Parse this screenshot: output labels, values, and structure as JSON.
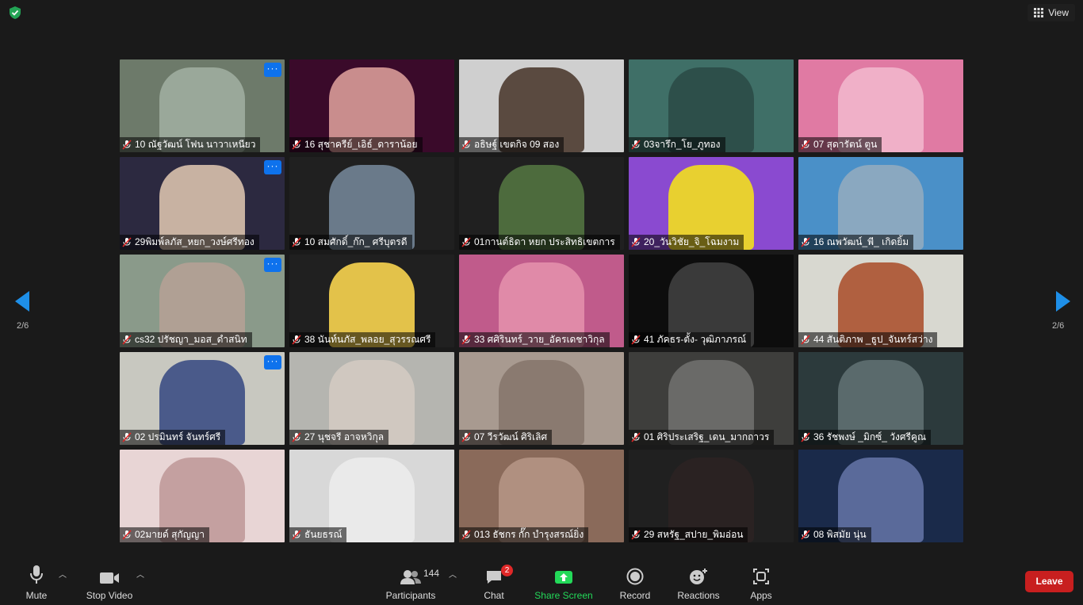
{
  "topbar": {
    "view_label": "View"
  },
  "pagination": {
    "left": "2/6",
    "right": "2/6"
  },
  "tiles": [
    {
      "name": "10 ณัฐวัฒน์ โฟน นาวาเหนียว",
      "bg": "#6d7a6a",
      "inner": "#9aa89a",
      "more": true
    },
    {
      "name": "16 สุชาครีย์_เอิธ์_ดาราน้อย",
      "bg": "#3a0a2a",
      "inner": "#c98d8d",
      "more": false
    },
    {
      "name": "อธิษฐ์ เขตกิจ 09 สอง",
      "bg": "#cfcfcf",
      "inner": "#5a4a40",
      "more": false
    },
    {
      "name": "03จารึก_โย_ภูทอง",
      "bg": "#3f6f67",
      "inner": "#2d4f4a",
      "more": false
    },
    {
      "name": "07 สุดารัตน์ ตูน",
      "bg": "#e07aa3",
      "inner": "#f0b0c8",
      "more": false
    },
    {
      "name": "29พิมพ์ลภัส_หยก_วงษ์ศรีทอง",
      "bg": "#2c2940",
      "inner": "#c8b2a2",
      "more": true
    },
    {
      "name": "10 สมศักดิ์_ก๊ก_ ศรีบุตรดี",
      "bg": "#202020",
      "inner": "#6a7a8a",
      "more": false
    },
    {
      "name": "01กานต์ธิดา หยก ประสิทธิเขตการ",
      "bg": "#202020",
      "inner": "#4d6b3d",
      "more": false
    },
    {
      "name": "20_วันวิชัย_จิ_โฉมงาม",
      "bg": "#8a4ad0",
      "inner": "#e8d030",
      "more": false
    },
    {
      "name": "16 ณพวัฒน์_พี_ เกิดยิ้ม",
      "bg": "#4a90c8",
      "inner": "#8aa8c0",
      "more": false
    },
    {
      "name": "cs32 ปรัชญา_มอส_ดำสนิท",
      "bg": "#8a9a8a",
      "inner": "#b0a094",
      "more": true
    },
    {
      "name": "38 นันท์นภัส_พลอย_สุวรรณศรี",
      "bg": "#202020",
      "inner": "#e3c24a",
      "more": false
    },
    {
      "name": "33 ศศิรินทร์_วาย_อัครเดชาวิกุล",
      "bg": "#c05b8b",
      "inner": "#e08aa8",
      "more": false
    },
    {
      "name": "41 ภัคธร-ตั้ง- วุฒิภาภรณ์",
      "bg": "#0d0d0d",
      "inner": "#3a3a3a",
      "more": false
    },
    {
      "name": "44 สันติภาพ _ธูป_จันทร์สว่าง",
      "bg": "#d8d8d0",
      "inner": "#b06040",
      "more": false
    },
    {
      "name": "02 ปรมินทร์ จันทร์ศรี",
      "bg": "#c8c8c0",
      "inner": "#4a5a8a",
      "more": true
    },
    {
      "name": "27 นุชจรี อาจหวิกุล",
      "bg": "#b5b5b0",
      "inner": "#d0c8c0",
      "more": false
    },
    {
      "name": "07 วีรวัฒน์ ศิริเลิศ",
      "bg": "#a89a90",
      "inner": "#8a7a70",
      "more": false
    },
    {
      "name": "01 ศิริประเสริฐ_เดน_มากถาวร",
      "bg": "#3e3e3c",
      "inner": "#6a6a68",
      "more": false
    },
    {
      "name": "36 รัชพงษ์ _มิกซ์_ วังศรีคูณ",
      "bg": "#2c3a3c",
      "inner": "#5a6a6c",
      "more": false
    },
    {
      "name": "02มายด์ สุกัญญา",
      "bg": "#e8d5d5",
      "inner": "#c4a0a0",
      "more": false
    },
    {
      "name": "ธันยธรณ์",
      "bg": "#d8d8d8",
      "inner": "#eaeaea",
      "more": false
    },
    {
      "name": "013 ธัชกร กั๊ก บำรุงสรณ์ยิ่ง",
      "bg": "#8a6a5a",
      "inner": "#b09080",
      "more": false
    },
    {
      "name": "29 สหรัฐ_สปาย_พิมอ่อน",
      "bg": "#202020",
      "inner": "#2a2222",
      "more": false
    },
    {
      "name": "08 พิสมัย นุ่น",
      "bg": "#1a2a4a",
      "inner": "#5a6a9a",
      "more": false
    }
  ],
  "toolbar": {
    "mute": "Mute",
    "stop_video": "Stop Video",
    "participants": "Participants",
    "participants_count": "144",
    "chat": "Chat",
    "chat_badge": "2",
    "share_screen": "Share Screen",
    "record": "Record",
    "reactions": "Reactions",
    "apps": "Apps",
    "leave": "Leave"
  },
  "colors": {
    "share_green": "#23d959",
    "leave_red": "#c81f1f",
    "accent_blue": "#0e72ed",
    "muted_red": "#e02828"
  }
}
